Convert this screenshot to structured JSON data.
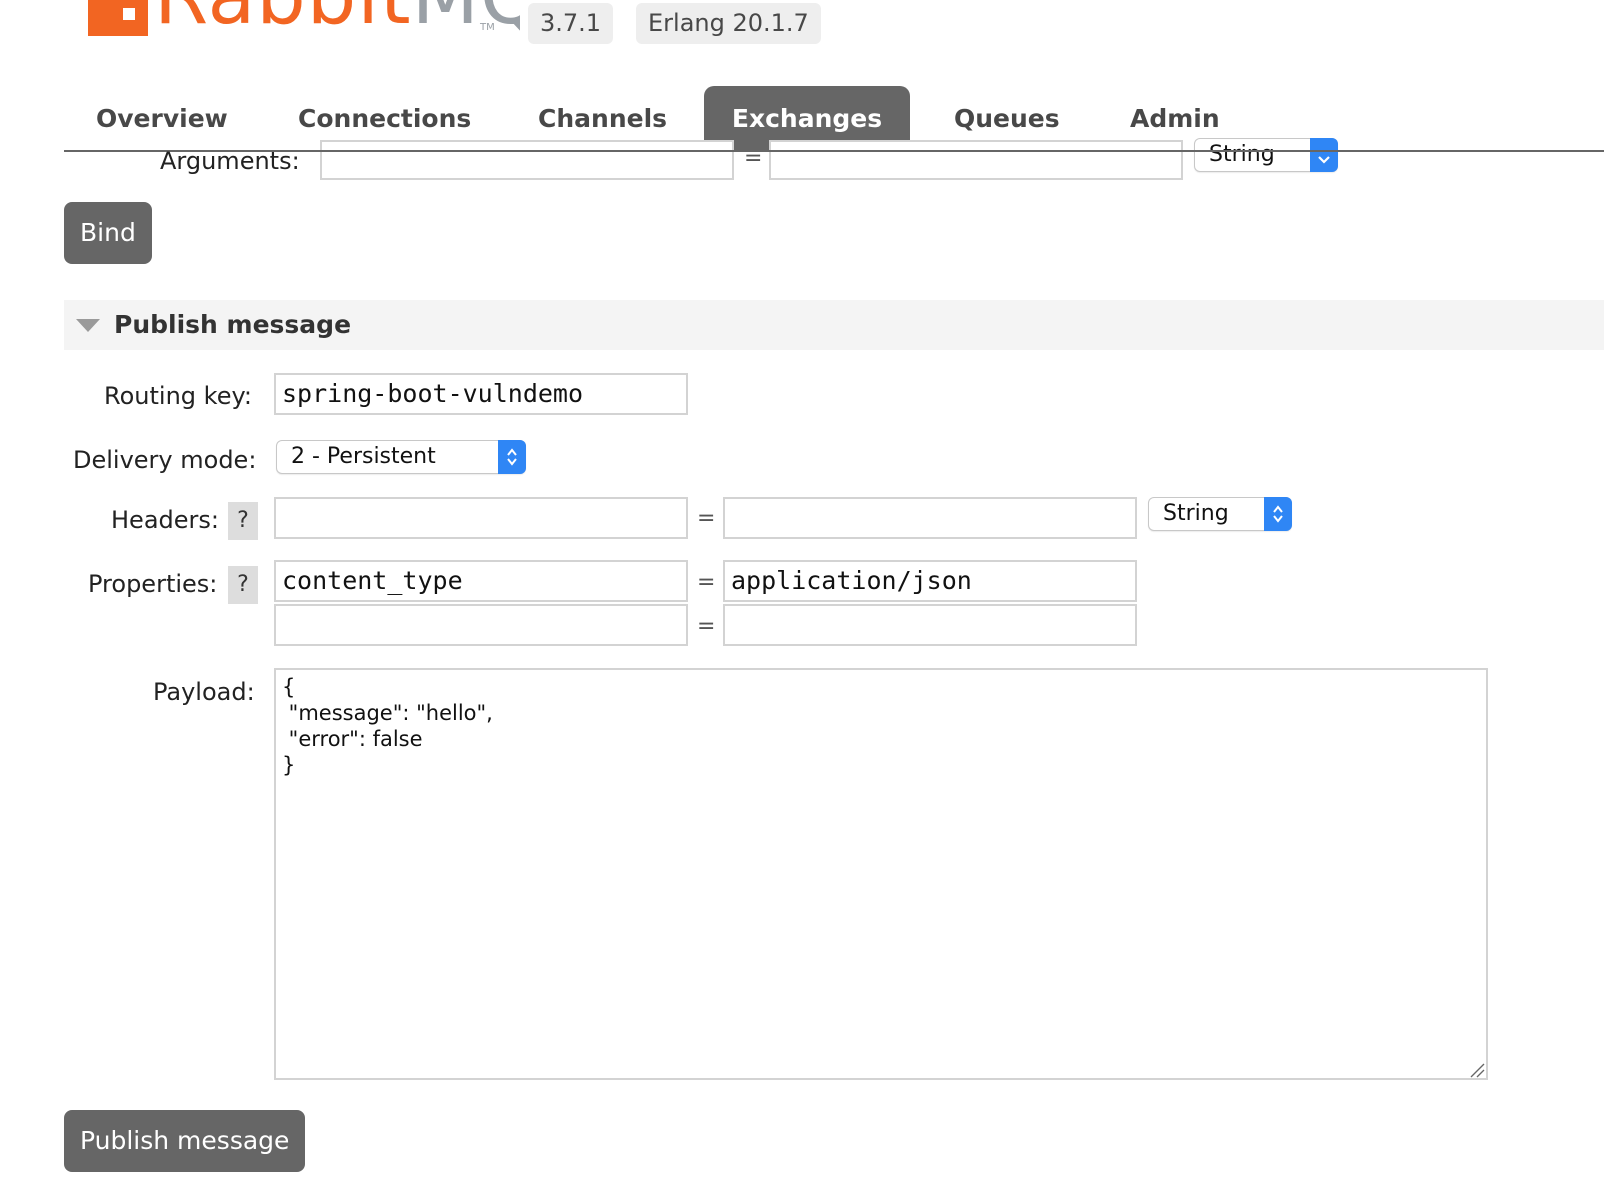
{
  "header": {
    "logo_text": "Rabbit",
    "logo_text_accent": "MQ",
    "logo_tm": "TM",
    "version": "3.7.1",
    "erlang": "Erlang 20.1.7"
  },
  "tabs": [
    {
      "label": "Overview"
    },
    {
      "label": "Connections"
    },
    {
      "label": "Channels"
    },
    {
      "label": "Exchanges"
    },
    {
      "label": "Queues"
    },
    {
      "label": "Admin"
    }
  ],
  "binding": {
    "arguments_label": "Arguments:",
    "arguments_key": "",
    "arguments_value": "",
    "equals": "=",
    "arguments_type": "String",
    "bind_button": "Bind"
  },
  "publish": {
    "section_title": "Publish message",
    "routing_key_label": "Routing key:",
    "routing_key_value": "spring-boot-vulndemo",
    "delivery_mode_label": "Delivery mode:",
    "delivery_mode_value": "2 - Persistent",
    "headers_label": "Headers:",
    "help": "?",
    "headers_key": "",
    "headers_value": "",
    "headers_type": "String",
    "properties_label": "Properties:",
    "properties": [
      {
        "key": "content_type",
        "value": "application/json"
      },
      {
        "key": "",
        "value": ""
      }
    ],
    "payload_label": "Payload:",
    "payload_value": "{\n \"message\": \"hello\",\n \"error\": false\n}",
    "publish_button": "Publish message"
  },
  "colors": {
    "brand": "#f26522",
    "tab_active": "#666666",
    "select_accent": "#2f86f5"
  }
}
